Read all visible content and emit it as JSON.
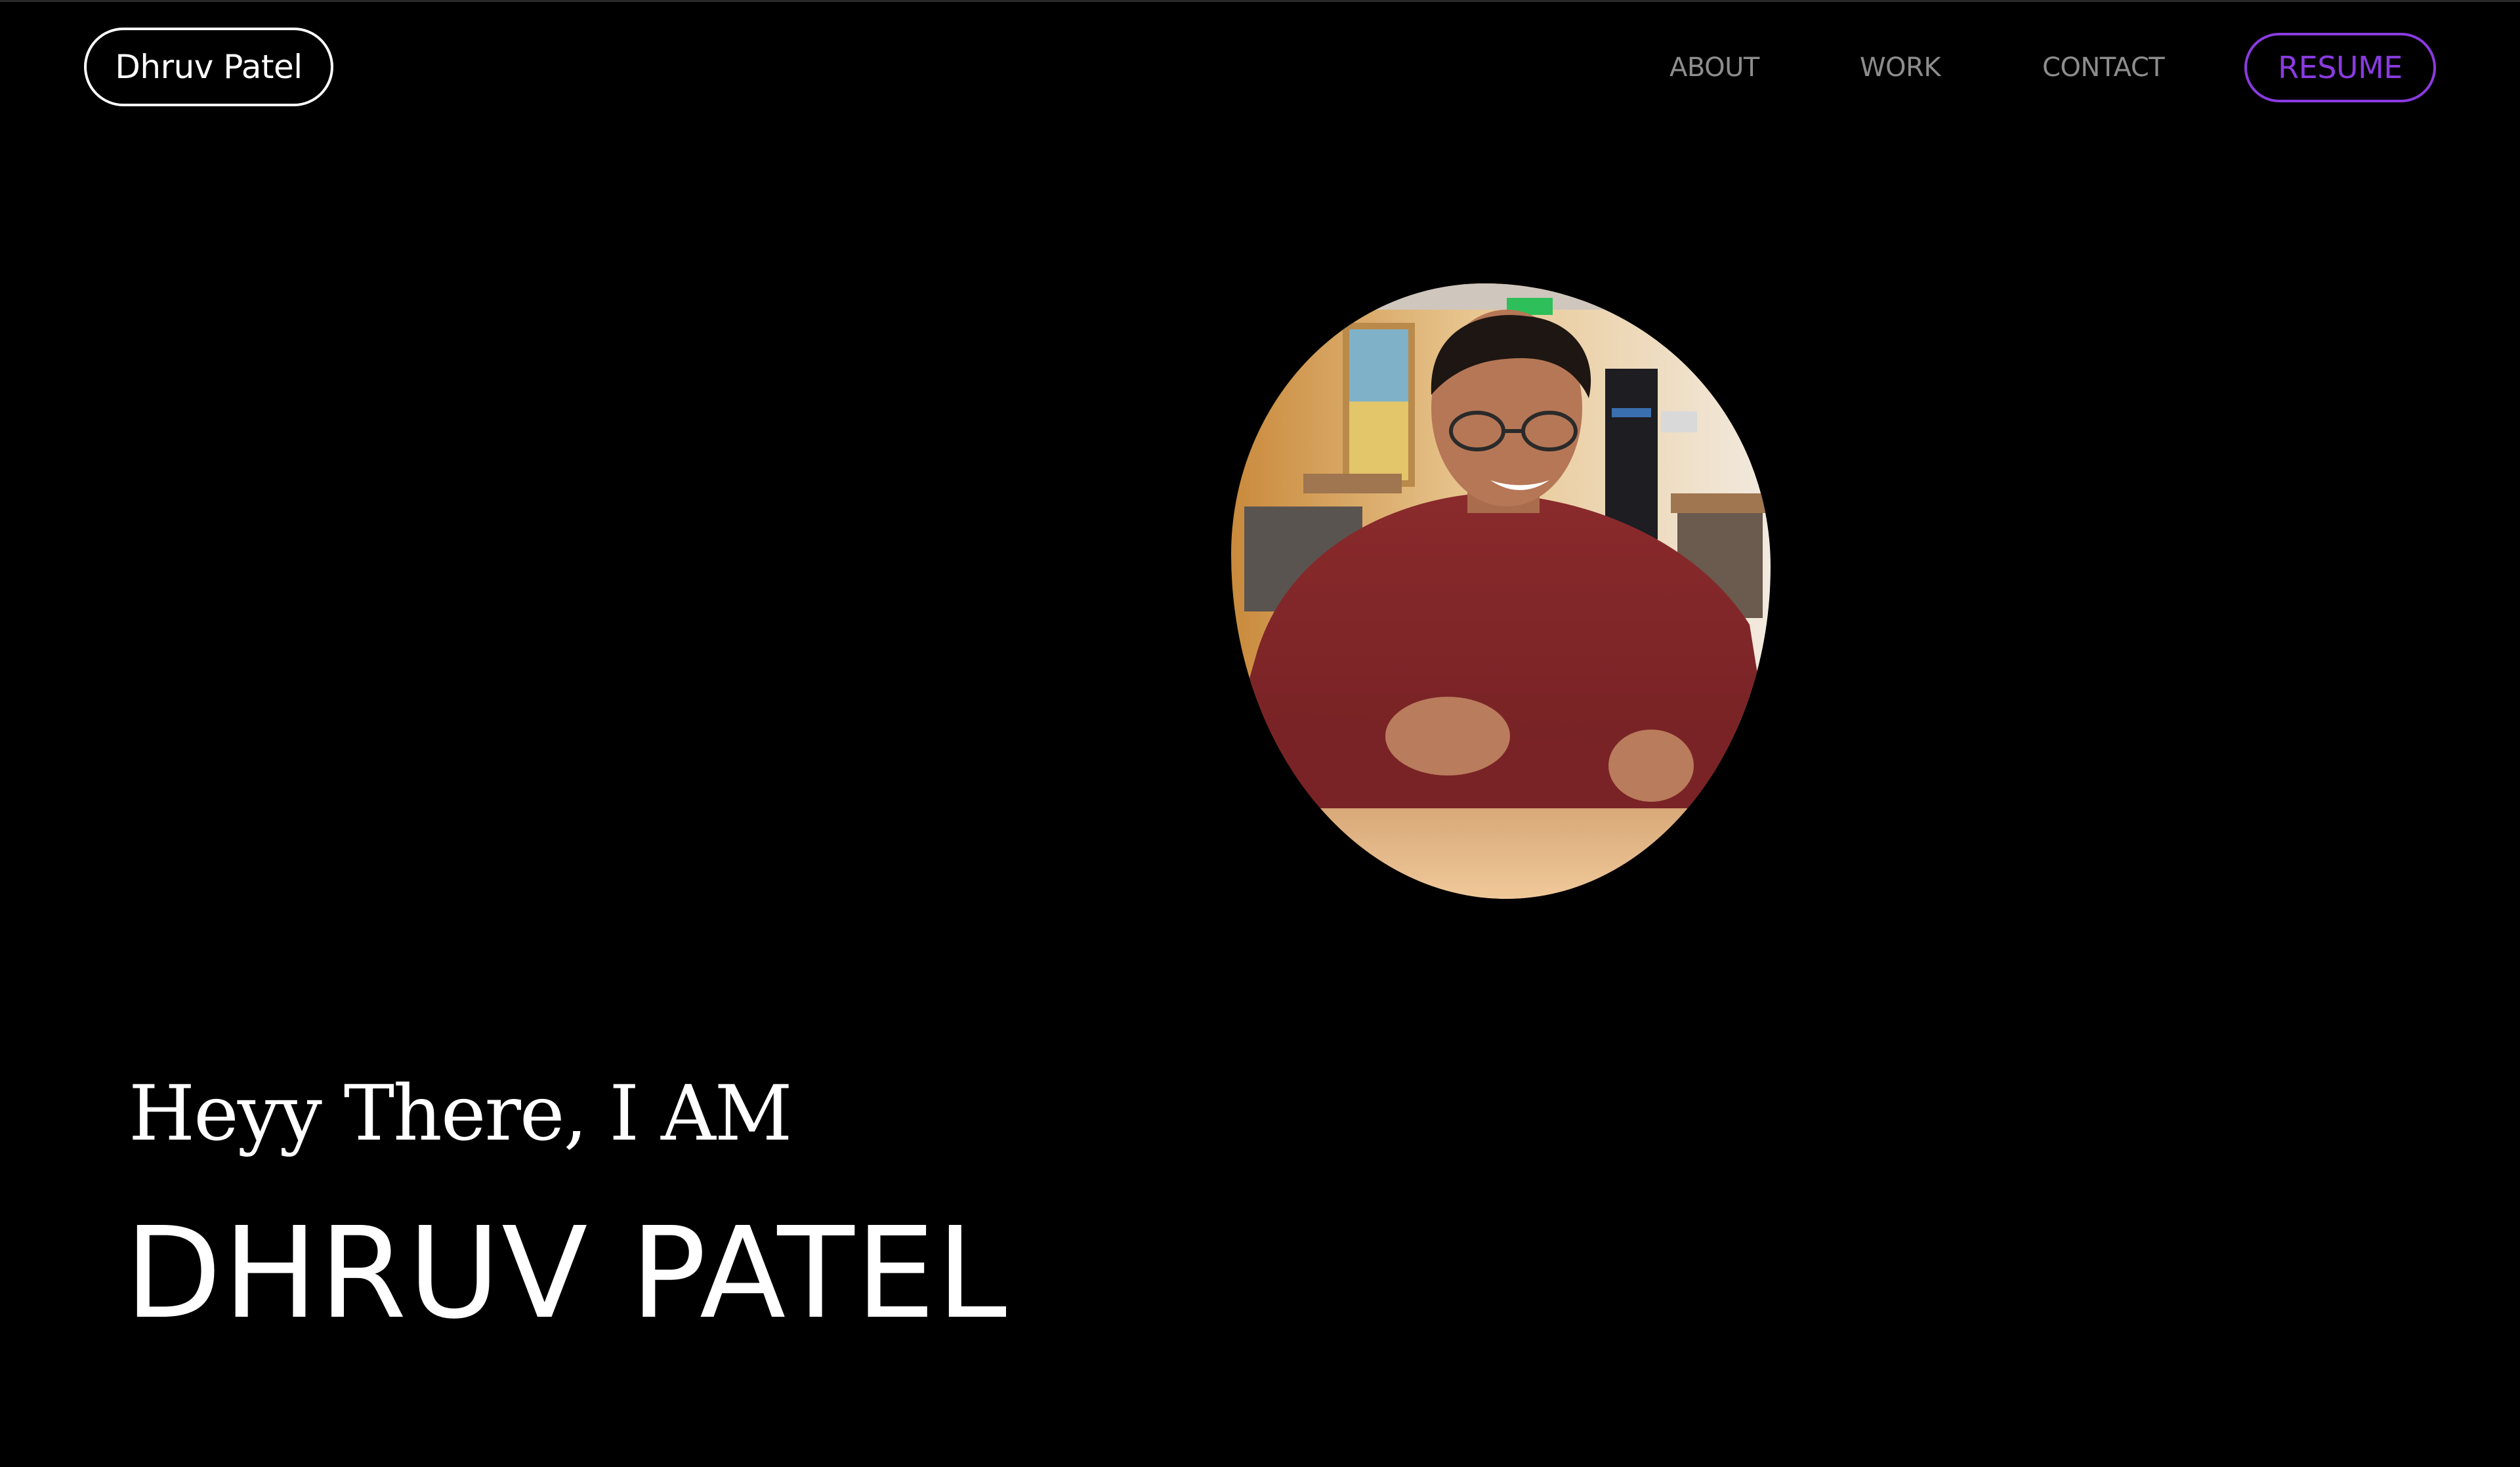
{
  "header": {
    "logo_label": "Dhruv Patel",
    "nav": {
      "about": "ABOUT",
      "work": "WORK",
      "contact": "CONTACT"
    },
    "resume_label": "RESUME"
  },
  "hero": {
    "greeting": "Heyy There, I AM",
    "name": "DHRUV PATEL",
    "photo_alt": "Dhruv Patel"
  },
  "colors": {
    "background": "#000000",
    "text": "#ffffff",
    "nav_text": "#8d8d8d",
    "accent": "#8a3be0"
  }
}
